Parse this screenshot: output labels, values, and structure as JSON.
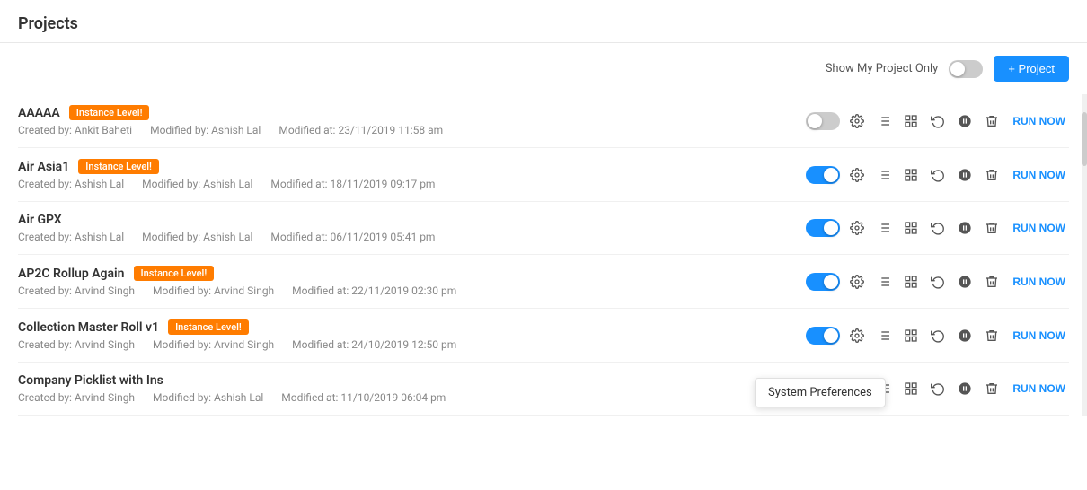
{
  "page": {
    "title": "Projects",
    "toolbar": {
      "show_my_label": "Show My Project Only",
      "add_button": "+ Project"
    }
  },
  "projects": [
    {
      "name": "AAAAA",
      "badge": "Instance Level!",
      "created_by": "Ankit Baheti",
      "modified_by": "Ashish Lal",
      "modified_at": "23/11/2019 11:58 am",
      "enabled": false
    },
    {
      "name": "Air Asia1",
      "badge": "Instance Level!",
      "created_by": "Ashish Lal",
      "modified_by": "Ashish Lal",
      "modified_at": "18/11/2019 09:17 pm",
      "enabled": true
    },
    {
      "name": "Air GPX",
      "badge": null,
      "created_by": "Ashish Lal",
      "modified_by": "Ashish Lal",
      "modified_at": "06/11/2019 05:41 pm",
      "enabled": true
    },
    {
      "name": "AP2C Rollup Again",
      "badge": "Instance Level!",
      "created_by": "Arvind Singh",
      "modified_by": "Arvind Singh",
      "modified_at": "22/11/2019 02:30 pm",
      "enabled": true
    },
    {
      "name": "Collection Master Roll v1",
      "badge": "Instance Level!",
      "created_by": "Arvind Singh",
      "modified_by": "Arvind Singh",
      "modified_at": "24/10/2019 12:50 pm",
      "enabled": true
    },
    {
      "name": "Company Picklist with Ins",
      "badge": null,
      "created_by": "Arvind Singh",
      "modified_by": "Ashish Lal",
      "modified_at": "11/10/2019 06:04 pm",
      "enabled": true
    }
  ],
  "tooltip": {
    "text": "System Preferences"
  },
  "labels": {
    "created_prefix": "Created by: ",
    "modified_by_prefix": "Modified by: ",
    "modified_at_prefix": "Modified at: ",
    "run_now": "RUN NOW"
  }
}
